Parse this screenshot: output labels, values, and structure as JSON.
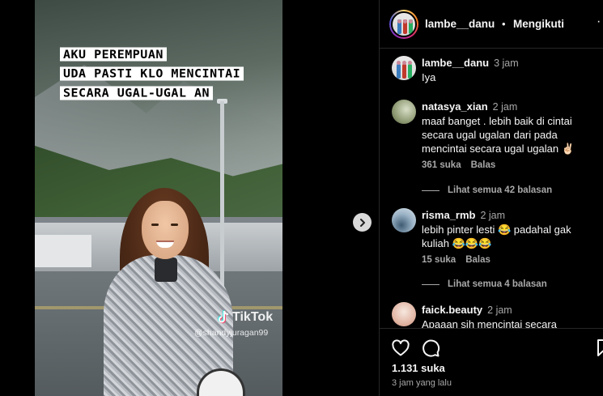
{
  "media": {
    "caption_lines": [
      "AKU PEREMPUAN",
      "UDA PASTI KLO MENCINTAI",
      "SECARA UGAL-UGAL AN"
    ],
    "watermark_brand": "TikTok",
    "watermark_user": "@shandyjuragan99"
  },
  "header": {
    "username": "lambe__danu",
    "separator": "•",
    "follow_label": "Mengikuti",
    "more": "···"
  },
  "comments": [
    {
      "username": "lambe__danu",
      "time": "3 jam",
      "text": "Iya",
      "avatar": "people-icon"
    },
    {
      "username": "natasya_xian",
      "time": "2 jam",
      "text": "maaf banget . lebih baik di cintai secara ugal ugalan dari pada mencintai secara ugal ugalan ✌🏻",
      "likes": "361 suka",
      "reply_label": "Balas",
      "view_replies": "Lihat semua 42 balasan",
      "avatar": "green-photo"
    },
    {
      "username": "risma_rmb",
      "time": "2 jam",
      "text": "lebih pinter lesti 😂 padahal gak kuliah 😂😂😂",
      "likes": "15 suka",
      "reply_label": "Balas",
      "view_replies": "Lihat semua 4 balasan",
      "avatar": "blue-photo"
    },
    {
      "username": "faick.beauty",
      "time": "2 jam",
      "text": "Apaaan sih mencintai secara",
      "avatar": "pink-photo"
    }
  ],
  "actions": {
    "likes": "1.131 suka",
    "time_ago": "3 jam yang lalu"
  },
  "colors": {
    "background": "#000000",
    "text_primary": "#f5f5f5",
    "text_secondary": "#a8a8a8",
    "divider": "#262626"
  }
}
